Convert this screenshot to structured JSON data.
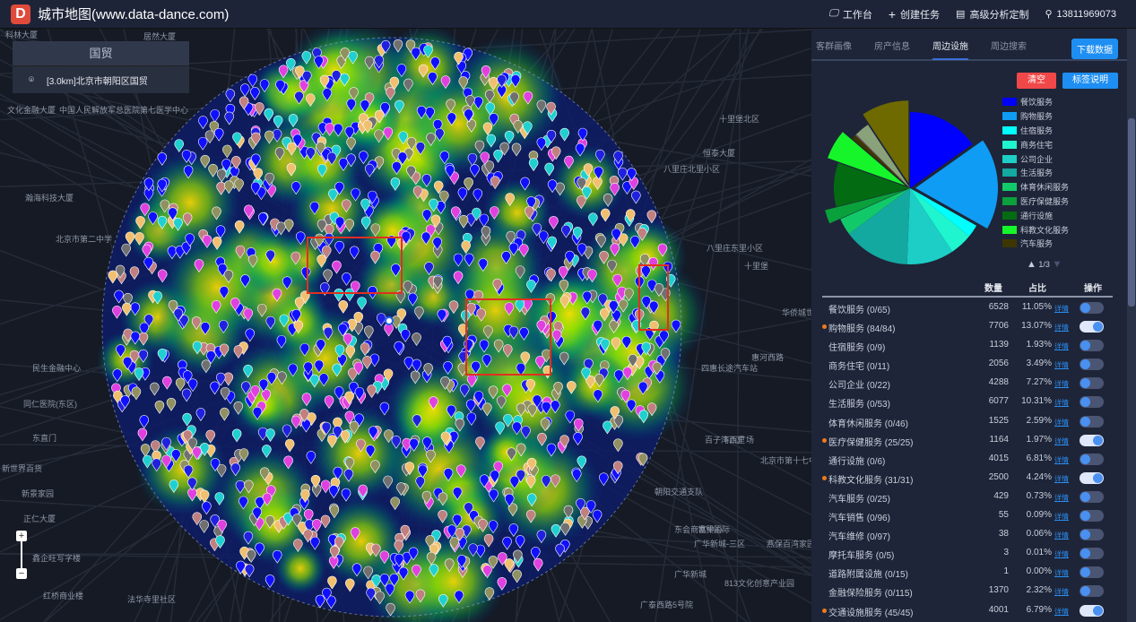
{
  "header": {
    "logo": "D",
    "title": "城市地图(www.data-dance.com)",
    "nav": [
      {
        "icon": "monitor-icon",
        "label": "工作台"
      },
      {
        "icon": "plus-icon",
        "label": "创建任务"
      },
      {
        "icon": "calendar-icon",
        "label": "高级分析定制"
      },
      {
        "icon": "user-icon",
        "label": "13811969073"
      }
    ]
  },
  "search": {
    "title": "国贸",
    "result": "[3.0km]北京市朝阳区国贸"
  },
  "map_labels": [
    "科林大厦",
    "居然大厦",
    "文化金融大厦",
    "中国人民解放军总医院第七医学中心",
    "瀚海科技大厦",
    "北京市第二中学",
    "民生金融中心",
    "同仁医院(东区)",
    "东直门",
    "新世界百货",
    "新景家园",
    "正仁大厦",
    "鑫企旺写字楼",
    "红桥商业楼",
    "法华寺里社区",
    "十里堡北区",
    "恒泰大厦",
    "八里庄北里小区",
    "八里庄东里小区",
    "十里堡",
    "华侨城世纪总部公园",
    "四惠长途汽车站",
    "百子湾西里",
    "下沉广场",
    "北京市第十七中学",
    "朝阳交通支队",
    "广华新城-三区",
    "燕保百湾家园",
    "广华新城",
    "东会商富中心",
    "813文化创意产业园",
    "广泰西路5号院",
    "世贸国际",
    "惠河西路"
  ],
  "panel": {
    "tabs": [
      "客群画像",
      "房产信息",
      "周边设施",
      "周边搜索"
    ],
    "active_tab": "周边设施",
    "download": "下载数据",
    "clear": "清空",
    "legend_btn": "标签说明",
    "pager": "1/3",
    "table_headers": {
      "count": "数量",
      "ratio": "占比",
      "action": "操作"
    },
    "detail_label": "详情"
  },
  "chart_data": {
    "type": "pie",
    "legend_placement": "right",
    "categories": [
      "餐饮服务",
      "购物服务",
      "住宿服务",
      "商务住宅",
      "公司企业",
      "生活服务",
      "体育休闲服务",
      "医疗保健服务",
      "通行设施",
      "科教文化服务",
      "汽车服务",
      "汽车销售",
      "汽车维修",
      "摩托车服务",
      "道路附属设施",
      "金融保险服务",
      "交通设施服务"
    ],
    "values": [
      6528,
      7706,
      1139,
      2056,
      4288,
      6077,
      1525,
      1164,
      4015,
      2500,
      429,
      55,
      38,
      3,
      1,
      1370,
      4001
    ],
    "colors": [
      "#0000ff",
      "#0f9cf5",
      "#00ffff",
      "#1ff5cf",
      "#1ccec6",
      "#13a8a0",
      "#12c96a",
      "#0aa03c",
      "#036b12",
      "#16f52a",
      "#3d3600",
      "#7a7a40",
      "#5a0ea0",
      "#7f00aa",
      "#888888",
      "#8aa27a",
      "#6e6a00"
    ]
  },
  "rows": [
    {
      "name": "餐饮服务 (0/65)",
      "count": "6528",
      "pct": "11.05%",
      "on": false
    },
    {
      "name": "购物服务 (84/84)",
      "count": "7706",
      "pct": "13.07%",
      "on": true
    },
    {
      "name": "住宿服务 (0/9)",
      "count": "1139",
      "pct": "1.93%",
      "on": false
    },
    {
      "name": "商务住宅 (0/11)",
      "count": "2056",
      "pct": "3.49%",
      "on": false
    },
    {
      "name": "公司企业 (0/22)",
      "count": "4288",
      "pct": "7.27%",
      "on": false
    },
    {
      "name": "生活服务 (0/53)",
      "count": "6077",
      "pct": "10.31%",
      "on": false
    },
    {
      "name": "体育休闲服务 (0/46)",
      "count": "1525",
      "pct": "2.59%",
      "on": false
    },
    {
      "name": "医疗保健服务 (25/25)",
      "count": "1164",
      "pct": "1.97%",
      "on": true
    },
    {
      "name": "通行设施 (0/6)",
      "count": "4015",
      "pct": "6.81%",
      "on": false
    },
    {
      "name": "科教文化服务 (31/31)",
      "count": "2500",
      "pct": "4.24%",
      "on": true
    },
    {
      "name": "汽车服务 (0/25)",
      "count": "429",
      "pct": "0.73%",
      "on": false
    },
    {
      "name": "汽车销售 (0/96)",
      "count": "55",
      "pct": "0.09%",
      "on": false
    },
    {
      "name": "汽车维修 (0/97)",
      "count": "38",
      "pct": "0.06%",
      "on": false
    },
    {
      "name": "摩托车服务 (0/5)",
      "count": "3",
      "pct": "0.01%",
      "on": false
    },
    {
      "name": "道路附属设施 (0/15)",
      "count": "1",
      "pct": "0.00%",
      "on": false
    },
    {
      "name": "金融保险服务 (0/115)",
      "count": "1370",
      "pct": "2.32%",
      "on": false
    },
    {
      "name": "交通设施服务 (45/45)",
      "count": "4001",
      "pct": "6.79%",
      "on": true
    }
  ]
}
